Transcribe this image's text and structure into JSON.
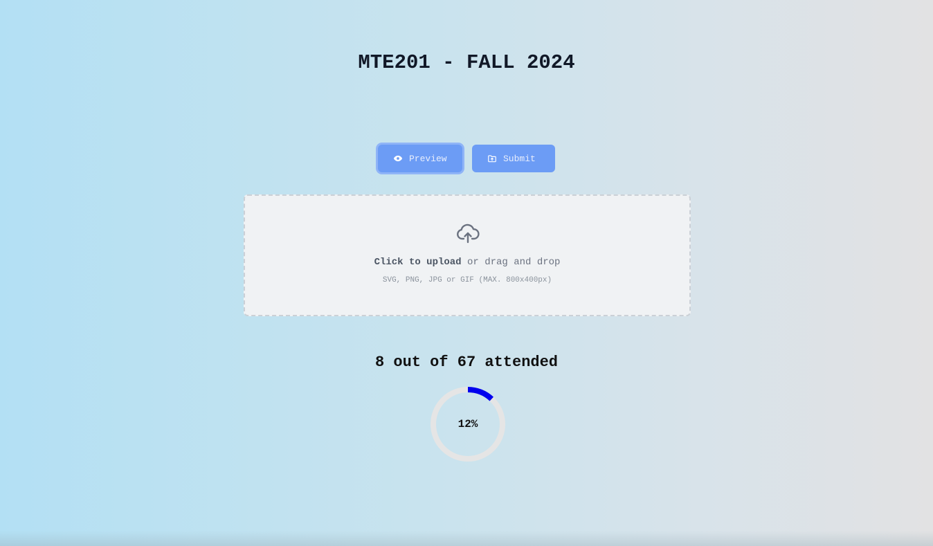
{
  "page": {
    "title": "MTE201 - FALL 2024"
  },
  "actions": {
    "preview_label": "Preview",
    "submit_label": "Submit",
    "preview_icon": "eye-icon",
    "submit_icon": "folder-upload-icon"
  },
  "upload": {
    "icon": "cloud-upload-icon",
    "click_text": "Click to upload",
    "drag_text": "or drag and drop",
    "hint": "SVG, PNG, JPG or GIF (MAX. 800x400px)"
  },
  "attendance": {
    "summary": "8 out of 67 attended",
    "percent_label": "12%",
    "fraction": 0.12,
    "ring_color": "#0000ee",
    "track_color": "#e5e5e5"
  },
  "colors": {
    "button": "#6c9cf5",
    "title": "#111827"
  }
}
